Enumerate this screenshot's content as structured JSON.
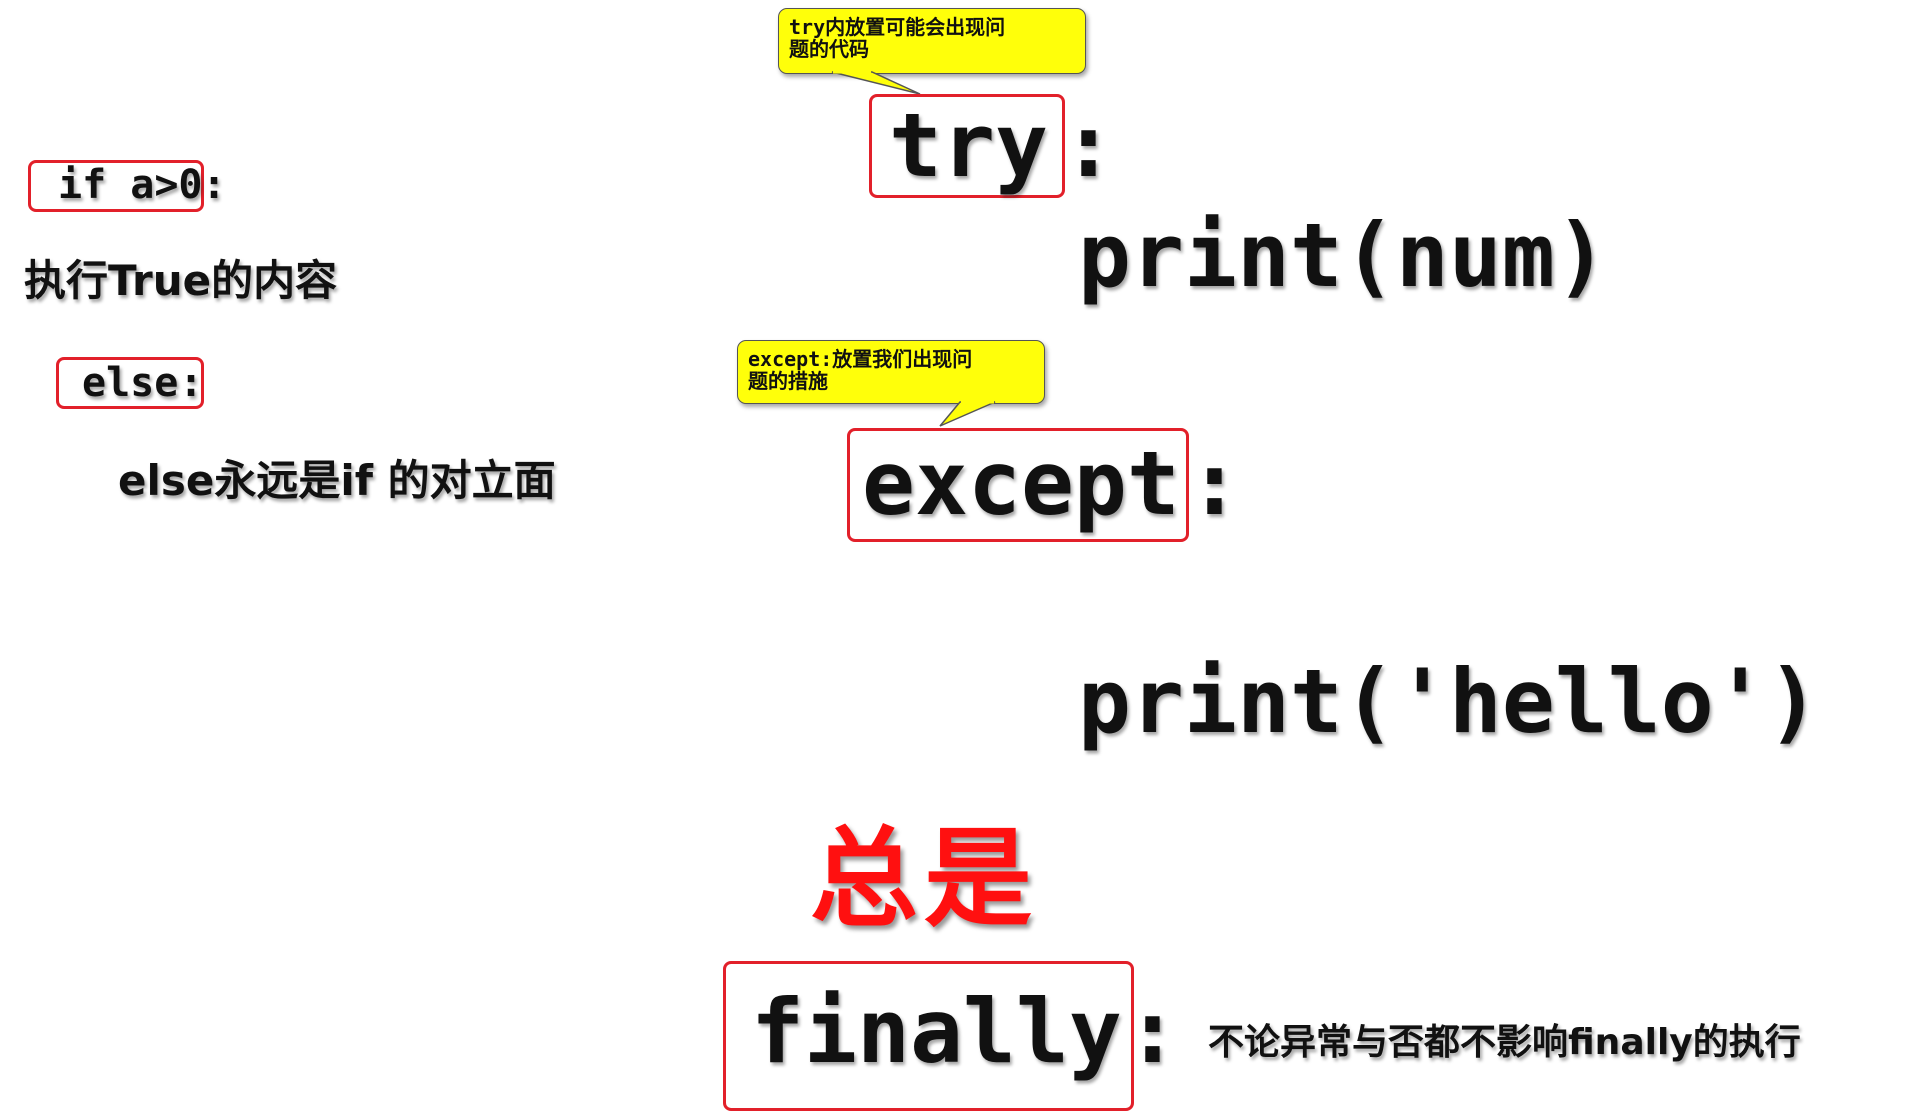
{
  "left_panel": {
    "if_keyword": "if a>0",
    "if_colon": ":",
    "true_body": "执行True的内容",
    "else_keyword": "else",
    "else_colon": ":",
    "else_note": "else永远是if 的对立面"
  },
  "code": {
    "try_keyword": "try",
    "try_colon": ":",
    "try_body": "print(num)",
    "except_keyword": "except",
    "except_colon": ":",
    "except_body": "print('hello')",
    "always_label": "总是",
    "finally_keyword": "finally",
    "finally_colon": ":",
    "finally_note": "不论异常与否都不影响finally的执行"
  },
  "callouts": {
    "try_note": "try内放置可能会出现问\n题的代码",
    "except_note": "except:放置我们出现问\n题的措施"
  },
  "colors": {
    "highlight_box": "#e2202a",
    "callout_fill": "#ffff0a",
    "always_text": "#ff1010",
    "text": "#111111"
  }
}
